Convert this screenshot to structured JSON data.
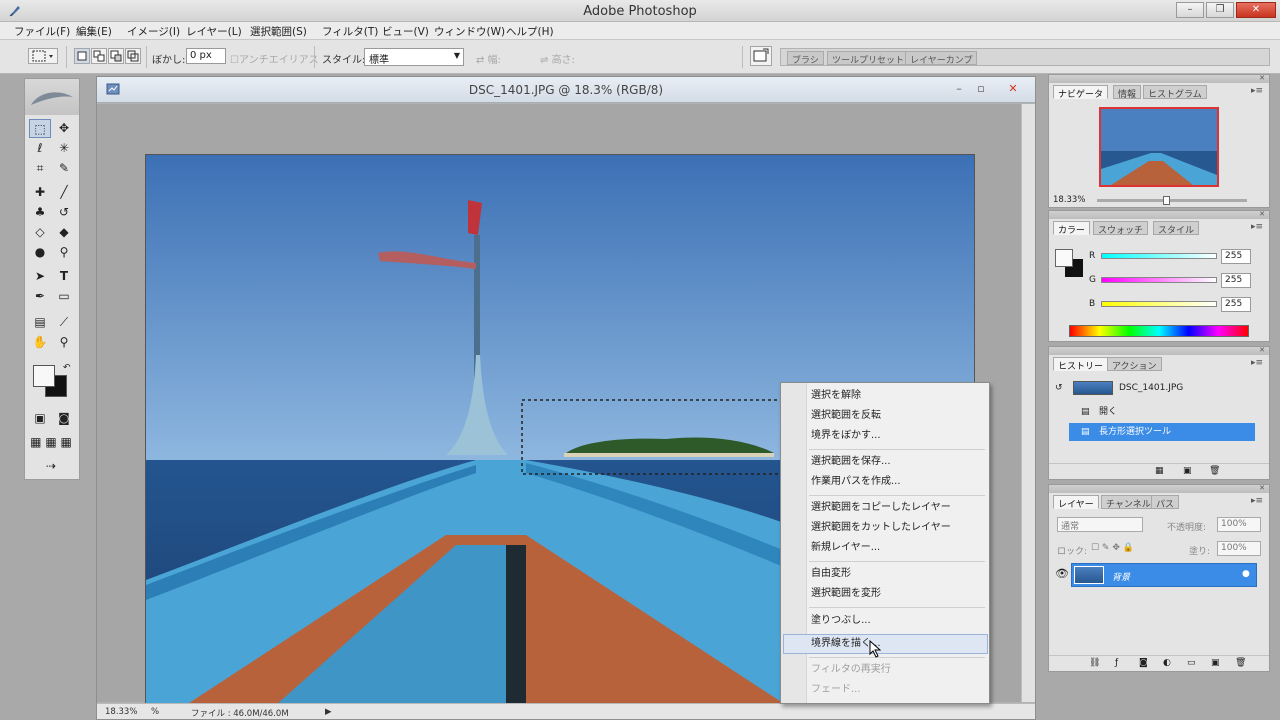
{
  "app": {
    "title": "Adobe Photoshop",
    "window_minimize": "–",
    "window_restore": "❐",
    "window_close": "✕"
  },
  "menu": [
    "ファイル(F)",
    "編集(E)",
    "イメージ(I)",
    "レイヤー(L)",
    "選択範囲(S)",
    "フィルタ(T)",
    "ビュー(V)",
    "ウィンドウ(W)",
    "ヘルプ(H)"
  ],
  "options": {
    "feather_label": "ぼかし:",
    "feather_value": "0 px",
    "antialias_label": "アンチエイリアス",
    "style_label": "スタイル:",
    "style_value": "標準",
    "width_label": "幅:",
    "height_label": "高さ:",
    "well_tabs": [
      "ブラシ",
      "ツールプリセット",
      "レイヤーカンプ"
    ]
  },
  "document": {
    "title": "DSC_1401.JPG @ 18.3% (RGB/8)",
    "zoom": "18.33%",
    "file_info": "ファイル : 46.0M/46.0M"
  },
  "context_menu": {
    "items": [
      {
        "label": "選択を解除",
        "enabled": true
      },
      {
        "label": "選択範囲を反転",
        "enabled": true
      },
      {
        "label": "境界をぼかす...",
        "enabled": true
      },
      {
        "label": "選択範囲を保存...",
        "enabled": true
      },
      {
        "label": "作業用パスを作成...",
        "enabled": true
      },
      {
        "label": "選択範囲をコピーしたレイヤー",
        "enabled": true
      },
      {
        "label": "選択範囲をカットしたレイヤー",
        "enabled": true
      },
      {
        "label": "新規レイヤー...",
        "enabled": true
      },
      {
        "label": "自由変形",
        "enabled": true
      },
      {
        "label": "選択範囲を変形",
        "enabled": true
      },
      {
        "label": "塗りつぶし...",
        "enabled": true
      },
      {
        "label": "境界線を描く...",
        "enabled": true,
        "highlighted": true
      },
      {
        "label": "フィルタの再実行",
        "enabled": false
      },
      {
        "label": "フェード...",
        "enabled": false
      }
    ]
  },
  "navigator_panel": {
    "tabs": [
      "ナビゲータ",
      "情報",
      "ヒストグラム"
    ],
    "zoom": "18.33%"
  },
  "color_panel": {
    "tabs": [
      "カラー",
      "スウォッチ",
      "スタイル"
    ],
    "channels": [
      {
        "label": "R",
        "value": "255"
      },
      {
        "label": "G",
        "value": "255"
      },
      {
        "label": "B",
        "value": "255"
      }
    ]
  },
  "history_panel": {
    "tabs": [
      "ヒストリー",
      "アクション"
    ],
    "snapshot": "DSC_1401.JPG",
    "states": [
      {
        "label": "開く",
        "selected": false
      },
      {
        "label": "長方形選択ツール",
        "selected": true
      }
    ]
  },
  "layers_panel": {
    "tabs": [
      "レイヤー",
      "チャンネル",
      "パス"
    ],
    "blend_mode": "通常",
    "opacity_label": "不透明度:",
    "opacity_value": "100%",
    "lock_label": "ロック:",
    "fill_label": "塗り:",
    "fill_value": "100%",
    "layers": [
      {
        "name": "背景",
        "selected": true
      }
    ]
  },
  "colors": {
    "accent": "#3b8ce6",
    "titlebar": "#d8d8d8",
    "panel_bg": "#e4e4e4"
  }
}
